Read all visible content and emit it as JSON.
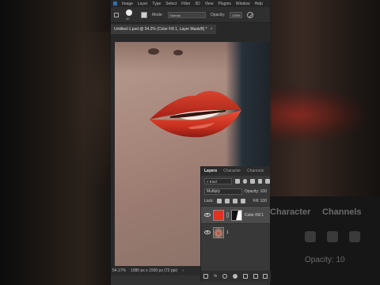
{
  "menubar": {
    "items": [
      "Image",
      "Layer",
      "Type",
      "Select",
      "Filter",
      "3D",
      "View",
      "Plugins",
      "Window",
      "Help"
    ]
  },
  "options_bar": {
    "brush_size": "40",
    "mode_label": "Mode:",
    "mode_value": "Normal",
    "opacity_label": "Opacity:",
    "opacity_value": "100%"
  },
  "document_tab": {
    "title": "Untitled-1.psd @ 54.2% (Color Fill 1, Layer Mask/8) *",
    "close": "×"
  },
  "status_bar": {
    "zoom": "54.17%",
    "doc_size": "1080 px x 1500 px (72 ppi)"
  },
  "layers_panel": {
    "tabs": [
      "Layers",
      "Character",
      "Channels"
    ],
    "active_tab": "Layers",
    "filter_kind": "Kind",
    "blend_mode": "Multiply",
    "opacity_label": "Opacity:",
    "opacity_value": "100",
    "lock_label": "Lock:",
    "fill_label": "Fill:",
    "fill_value": "100",
    "layers": [
      {
        "name": "Color Fill 1",
        "color": "#e2321f",
        "selected": true
      },
      {
        "name": "1",
        "selected": false
      }
    ],
    "footer_icons": [
      "link-icon",
      "fx-icon",
      "mask-icon",
      "adjustment-icon",
      "folder-icon",
      "new-layer-icon",
      "trash-icon"
    ],
    "footer_fx": "fx"
  },
  "background_panel": {
    "tab_character": "Character",
    "tab_channels": "Channels",
    "opacity_label": "Opacity:",
    "opacity_value": "10"
  },
  "colors": {
    "fill": "#e2321f",
    "app_bg": "#323232",
    "panel_bg": "#383838"
  }
}
